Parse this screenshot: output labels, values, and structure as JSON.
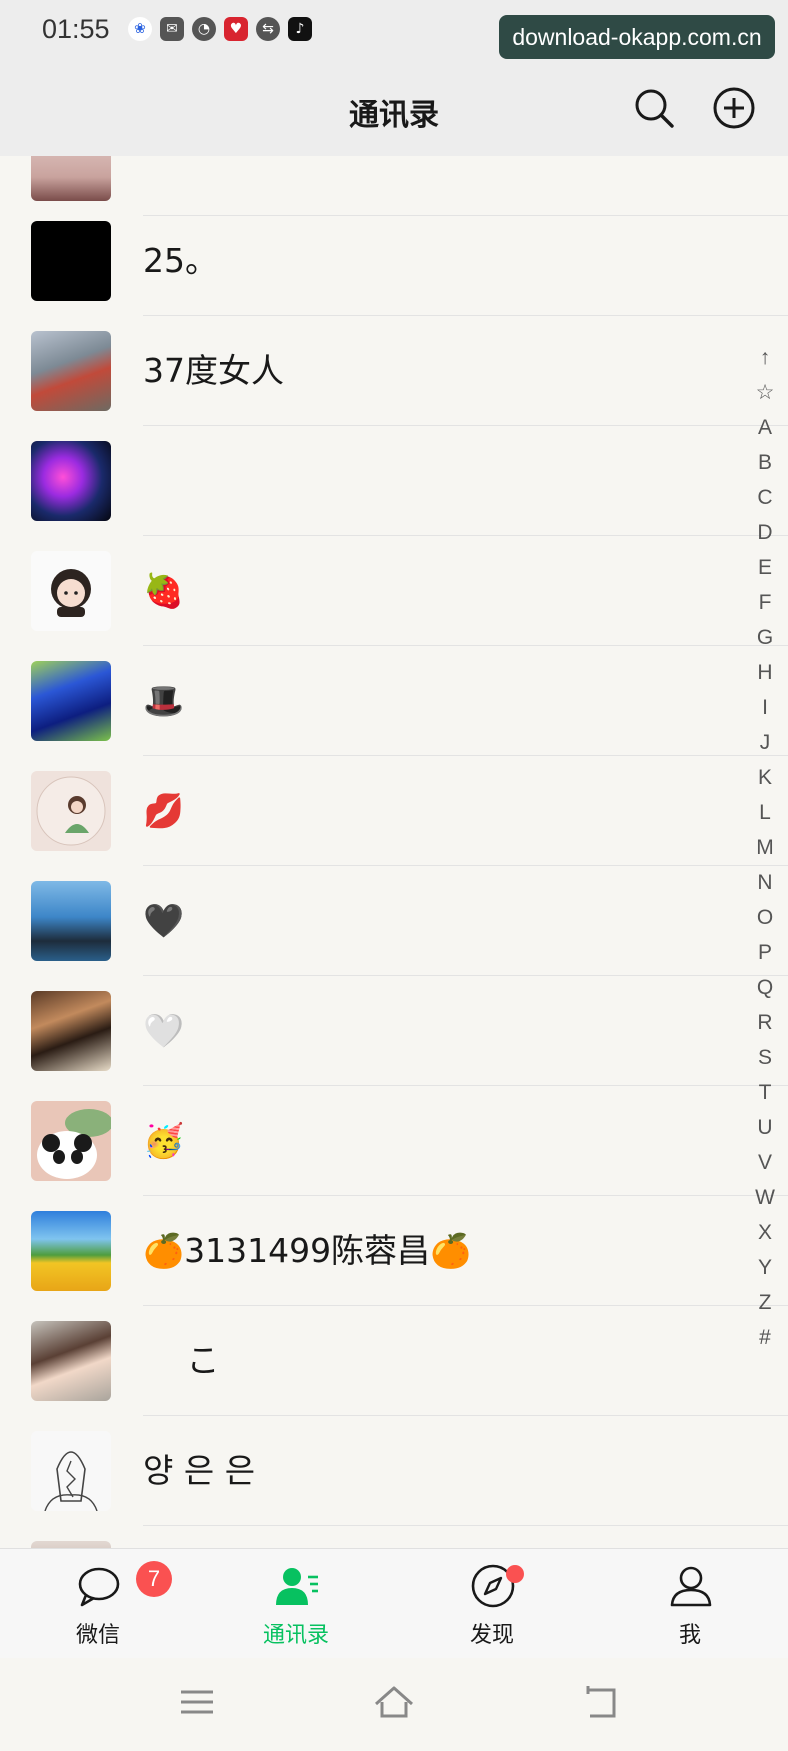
{
  "status": {
    "time": "01:55",
    "watermark": "download-okapp.com.cn"
  },
  "header": {
    "title": "通讯录"
  },
  "contacts": [
    {
      "name": "25。",
      "avatar": "avatar-black"
    },
    {
      "name": "37度女人",
      "avatar": "avatar-go-kart-photo"
    },
    {
      "name": "",
      "avatar": "avatar-jellyfish"
    },
    {
      "name": "🍓",
      "avatar": "avatar-cartoon-girl"
    },
    {
      "name": "🎩",
      "avatar": "avatar-blue-car"
    },
    {
      "name": "💋",
      "avatar": "avatar-girl-portrait"
    },
    {
      "name": "🖤",
      "avatar": "avatar-seaside-photo"
    },
    {
      "name": "🤍",
      "avatar": "avatar-piano-photo"
    },
    {
      "name": "🥳",
      "avatar": "avatar-panda-cartoon"
    },
    {
      "name": "🍊3131499陈蓉昌🍊",
      "avatar": "avatar-flower-field"
    },
    {
      "name": "　 こ",
      "avatar": "avatar-woman-selfie"
    },
    {
      "name": "양 은 은",
      "avatar": "avatar-braid-sketch"
    }
  ],
  "index_letters": [
    "↑",
    "☆",
    "A",
    "B",
    "C",
    "D",
    "E",
    "F",
    "G",
    "H",
    "I",
    "J",
    "K",
    "L",
    "M",
    "N",
    "O",
    "P",
    "Q",
    "R",
    "S",
    "T",
    "U",
    "V",
    "W",
    "X",
    "Y",
    "Z",
    "#"
  ],
  "tabs": [
    {
      "label": "微信",
      "icon": "chat-bubble-icon",
      "badge": "7"
    },
    {
      "label": "通讯录",
      "icon": "contacts-icon",
      "active": true
    },
    {
      "label": "发现",
      "icon": "compass-icon",
      "dot": true
    },
    {
      "label": "我",
      "icon": "person-icon"
    }
  ],
  "colors": {
    "accent": "#07c160",
    "badge": "#fa5151",
    "header_bg": "#ededed",
    "list_bg": "#f7f6f2"
  }
}
